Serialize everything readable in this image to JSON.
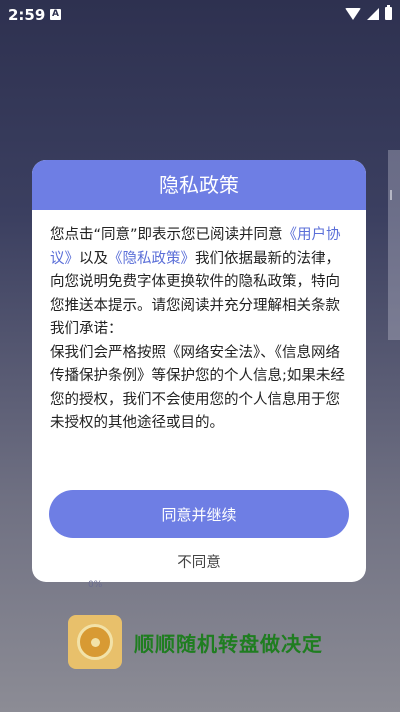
{
  "status_bar": {
    "time": "2:59",
    "notification_badge": "A"
  },
  "dialog": {
    "title": "隐私政策",
    "body_intro": "您点击“同意”即表示您已阅读并同意",
    "link_user_agreement": "《用户协议》",
    "body_mid": "以及",
    "link_privacy_policy": "《隐私政策》",
    "body_rest": "我们依据最新的法律，向您说明免费字体更换软件的隐私政策，特向您推送本提示。请您阅读并充分理解相关条款我们承诺：",
    "body_para2": "保我们会严格按照《网络安全法》、《信息网络传播保护条例》等保护您的个人信息;如果未经您的授权，我们不会使用您的个人信息用于您未授权的其他途径或目的。",
    "agree_label": "同意并继续",
    "disagree_label": "不同意"
  },
  "background": {
    "version_hint": "0%",
    "promo_text": "顺顺随机转盘做决定"
  },
  "colors": {
    "accent": "#6e7ee4",
    "promo_green": "#1f7d20"
  }
}
